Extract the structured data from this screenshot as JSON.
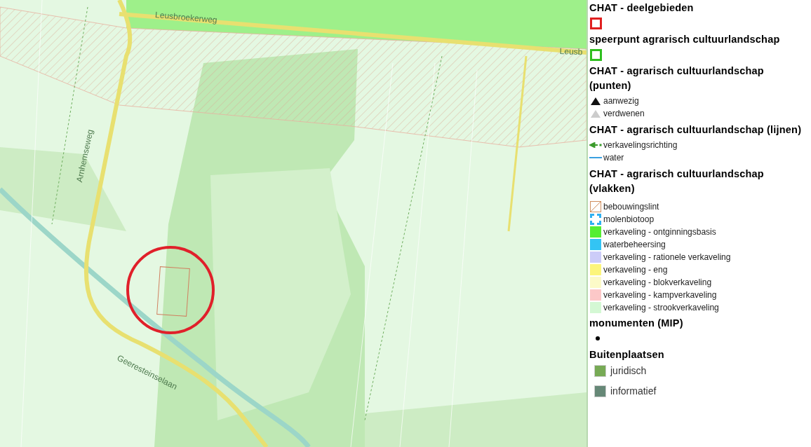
{
  "map": {
    "road_labels": [
      {
        "text": "Leusbroekerweg",
        "kind": "top"
      },
      {
        "text": "Leusb",
        "kind": "top-right"
      },
      {
        "text": "Arnhemseweg",
        "kind": "left"
      },
      {
        "text": "Geeresteinselaan",
        "kind": "bottom"
      }
    ]
  },
  "legend": {
    "sections": [
      {
        "title": "CHAT - deelgebieden",
        "items": [
          {
            "kind": "outline",
            "color": "#e02020"
          }
        ]
      },
      {
        "title": "speerpunt agrarisch cultuurlandschap",
        "items": [
          {
            "kind": "outline",
            "color": "#2fbf1f"
          }
        ]
      },
      {
        "title": "CHAT - agrarisch cultuurlandschap (punten)",
        "items": [
          {
            "kind": "triangle",
            "label": "aanwezig",
            "color": "#111111"
          },
          {
            "kind": "triangle",
            "label": "verdwenen",
            "color": "#cccccc"
          }
        ]
      },
      {
        "title": "CHAT - agrarisch cultuurlandschap (lijnen)",
        "items": [
          {
            "kind": "arrow",
            "label": "verkavelingsrichting",
            "color": "#3a9a2a"
          },
          {
            "kind": "line",
            "label": "water",
            "color": "#3aa0e0"
          }
        ]
      },
      {
        "title": "CHAT - agrarisch cultuurlandschap (vlakken)",
        "items": [
          {
            "kind": "hatch",
            "label": "bebouwingslint",
            "color": "#d09060"
          },
          {
            "kind": "dashed",
            "label": "molenbiotoop",
            "color": "#30b0f0"
          },
          {
            "kind": "fill",
            "label": "verkaveling - ontginningsbasis",
            "color": "#55ee33"
          },
          {
            "kind": "fill",
            "label": "waterbeheersing",
            "color": "#33c4f4"
          },
          {
            "kind": "fill",
            "label": "verkaveling - rationele verkaveling",
            "color": "#ccccf8"
          },
          {
            "kind": "fill",
            "label": "verkaveling - eng",
            "color": "#fcf57c"
          },
          {
            "kind": "fill",
            "label": "verkaveling - blokverkaveling",
            "color": "#fcfac8"
          },
          {
            "kind": "fill",
            "label": "verkaveling - kampverkaveling",
            "color": "#fcc8c8"
          },
          {
            "kind": "fill",
            "label": "verkaveling - strookverkaveling",
            "color": "#d4f8d4"
          }
        ]
      },
      {
        "title": "monumenten (MIP)",
        "items": [
          {
            "kind": "dot",
            "color": "#000000"
          }
        ]
      },
      {
        "title": "Buitenplaatsen",
        "items": [
          {
            "kind": "swatch",
            "label": "juridisch",
            "color": "#77aa55"
          },
          {
            "kind": "swatch",
            "label": "informatief",
            "color": "#668877"
          }
        ]
      }
    ]
  }
}
